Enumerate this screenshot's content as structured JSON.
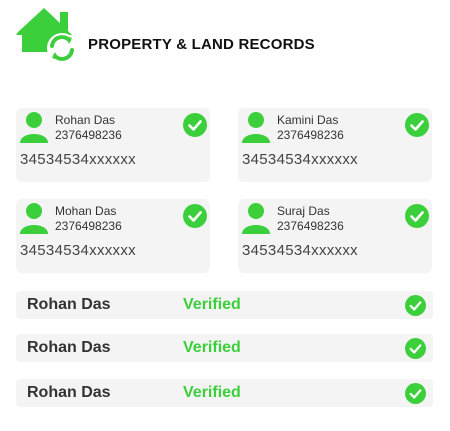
{
  "header": {
    "title": "PROPERTY & LAND RECORDS",
    "logo_icon": "house-refresh-icon",
    "brand_color": "#3ccf3c"
  },
  "cards": [
    {
      "name": "Rohan Das",
      "phone": "2376498236",
      "code": "34534534xxxxxx",
      "status_icon": "check-circle-icon"
    },
    {
      "name": "Kamini Das",
      "phone": "2376498236",
      "code": "34534534xxxxxx",
      "status_icon": "check-circle-icon"
    },
    {
      "name": "Mohan Das",
      "phone": "2376498236",
      "code": "34534534xxxxxx",
      "status_icon": "check-circle-icon"
    },
    {
      "name": "Suraj Das",
      "phone": "2376498236",
      "code": "34534534xxxxxx",
      "status_icon": "check-circle-icon"
    }
  ],
  "rows": [
    {
      "name": "Rohan Das",
      "status": "Verified"
    },
    {
      "name": "Rohan Das",
      "status": "Verified"
    },
    {
      "name": "Rohan Das",
      "status": "Verified"
    }
  ]
}
